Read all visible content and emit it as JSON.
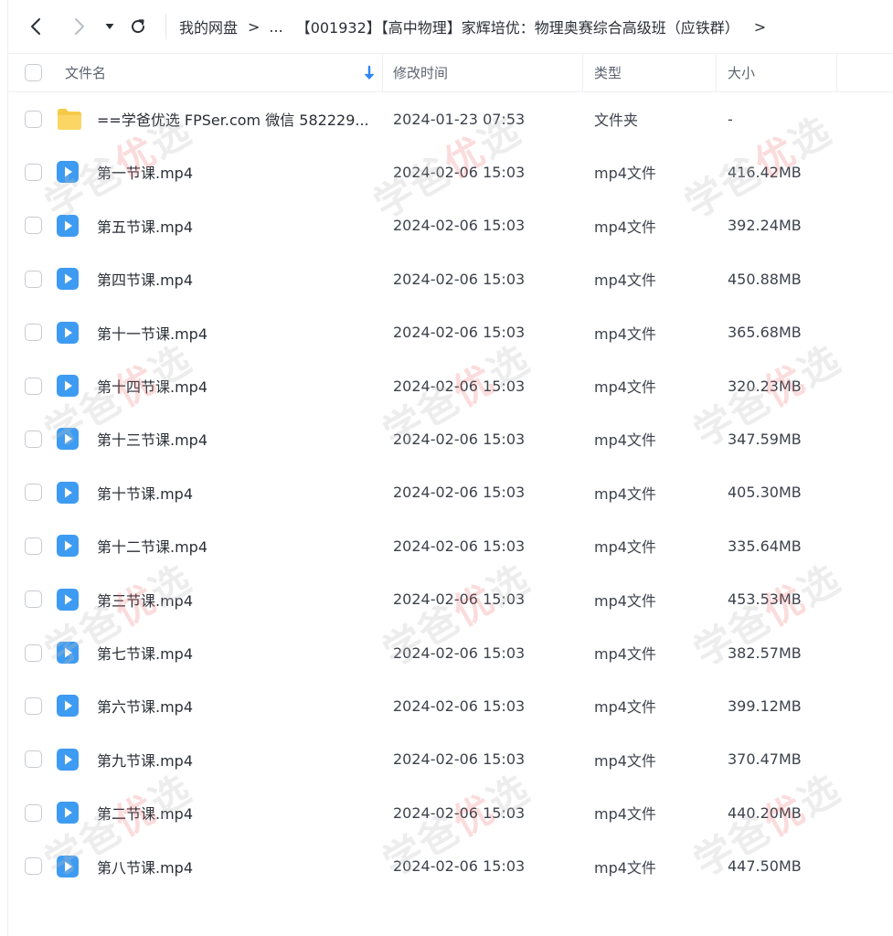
{
  "breadcrumb": {
    "root": "我的网盘",
    "ellipsis": "...",
    "current": "【001932】【高中物理】家辉培优：物理奥赛综合高级班（应铁群）",
    "separator": ">"
  },
  "columns": {
    "name": "文件名",
    "modified": "修改时间",
    "type": "类型",
    "size": "大小"
  },
  "files": [
    {
      "name": "==学爸优选 FPSer.com 微信 582229...",
      "modified": "2024-01-23 07:53",
      "type": "文件夹",
      "size": "-",
      "icon": "folder-icon"
    },
    {
      "name": "第一节课.mp4",
      "modified": "2024-02-06 15:03",
      "type": "mp4文件",
      "size": "416.42MB",
      "icon": "video-icon"
    },
    {
      "name": "第五节课.mp4",
      "modified": "2024-02-06 15:03",
      "type": "mp4文件",
      "size": "392.24MB",
      "icon": "video-icon"
    },
    {
      "name": "第四节课.mp4",
      "modified": "2024-02-06 15:03",
      "type": "mp4文件",
      "size": "450.88MB",
      "icon": "video-icon"
    },
    {
      "name": "第十一节课.mp4",
      "modified": "2024-02-06 15:03",
      "type": "mp4文件",
      "size": "365.68MB",
      "icon": "video-icon"
    },
    {
      "name": "第十四节课.mp4",
      "modified": "2024-02-06 15:03",
      "type": "mp4文件",
      "size": "320.23MB",
      "icon": "video-icon"
    },
    {
      "name": "第十三节课.mp4",
      "modified": "2024-02-06 15:03",
      "type": "mp4文件",
      "size": "347.59MB",
      "icon": "video-icon"
    },
    {
      "name": "第十节课.mp4",
      "modified": "2024-02-06 15:03",
      "type": "mp4文件",
      "size": "405.30MB",
      "icon": "video-icon"
    },
    {
      "name": "第十二节课.mp4",
      "modified": "2024-02-06 15:03",
      "type": "mp4文件",
      "size": "335.64MB",
      "icon": "video-icon"
    },
    {
      "name": "第三节课.mp4",
      "modified": "2024-02-06 15:03",
      "type": "mp4文件",
      "size": "453.53MB",
      "icon": "video-icon"
    },
    {
      "name": "第七节课.mp4",
      "modified": "2024-02-06 15:03",
      "type": "mp4文件",
      "size": "382.57MB",
      "icon": "video-icon"
    },
    {
      "name": "第六节课.mp4",
      "modified": "2024-02-06 15:03",
      "type": "mp4文件",
      "size": "399.12MB",
      "icon": "video-icon"
    },
    {
      "name": "第九节课.mp4",
      "modified": "2024-02-06 15:03",
      "type": "mp4文件",
      "size": "370.47MB",
      "icon": "video-icon"
    },
    {
      "name": "第二节课.mp4",
      "modified": "2024-02-06 15:03",
      "type": "mp4文件",
      "size": "440.20MB",
      "icon": "video-icon"
    },
    {
      "name": "第八节课.mp4",
      "modified": "2024-02-06 15:03",
      "type": "mp4文件",
      "size": "447.50MB",
      "icon": "video-icon"
    }
  ],
  "watermark": {
    "prefix": "学爸",
    "highlight": "优",
    "suffix": "选"
  },
  "colors": {
    "accent": "#2f86f6",
    "folder": "#f7c948",
    "video": "#3e9bf2"
  }
}
